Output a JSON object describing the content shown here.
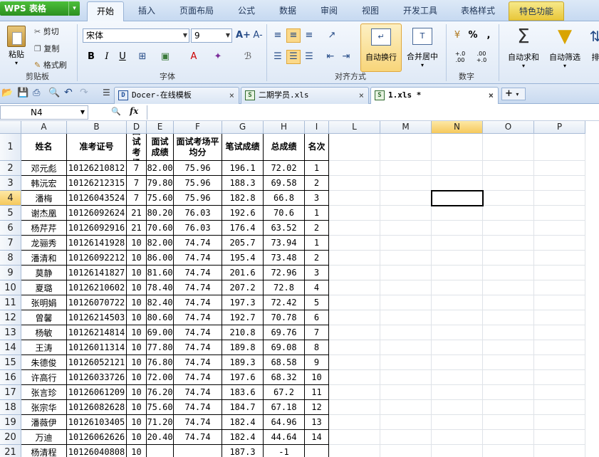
{
  "app": {
    "logo": "WPS 表格",
    "tabs": [
      "开始",
      "插入",
      "页面布局",
      "公式",
      "数据",
      "审阅",
      "视图",
      "开发工具",
      "表格样式",
      "特色功能"
    ]
  },
  "ribbon": {
    "clipboard": {
      "paste": "粘贴",
      "cut": "剪切",
      "copy": "复制",
      "format_painter": "格式刷",
      "group": "剪贴板"
    },
    "font": {
      "name": "宋体",
      "size": "9",
      "group": "字体",
      "bold": "B",
      "italic": "I",
      "underline": "U",
      "grow": "A+",
      "shrink": "A-"
    },
    "align": {
      "wrap": "自动换行",
      "merge": "合并居中",
      "group": "对齐方式"
    },
    "number": {
      "percent": "%",
      "comma": ",",
      "inc": "+.0 .00",
      "dec": ".00 +.0",
      "group": "数字"
    },
    "autosum": "自动求和",
    "autofilter": "自动筛选",
    "more": "排"
  },
  "doc_tabs": [
    {
      "label": "Docer-在线模板",
      "icon": "D"
    },
    {
      "label": "二期学员.xls",
      "icon": "S"
    },
    {
      "label": "1.xls *",
      "icon": "S"
    }
  ],
  "formula_bar": {
    "name_box": "N4",
    "fx": "fx",
    "formula": ""
  },
  "columns": [
    "A",
    "B",
    "D",
    "E",
    "F",
    "G",
    "H",
    "I",
    "L",
    "M",
    "N",
    "O",
    "P"
  ],
  "selected_column": "N",
  "selected_row": "4",
  "row_numbers": [
    "1",
    "2",
    "3",
    "4",
    "5",
    "6",
    "7",
    "8",
    "9",
    "10",
    "11",
    "12",
    "13",
    "14",
    "15",
    "16",
    "17",
    "18",
    "19",
    "20",
    "21"
  ],
  "header_row": [
    "姓名",
    "准考证号",
    "面试考场",
    "面试成绩",
    "面试考场平均分",
    "笔试成绩",
    "总成绩",
    "名次"
  ],
  "rows": [
    [
      "邓元彪",
      "10126210812",
      "7",
      "82.00",
      "75.96",
      "196.1",
      "72.02",
      "1"
    ],
    [
      "韩沅宏",
      "10126212315",
      "7",
      "79.80",
      "75.96",
      "188.3",
      "69.58",
      "2"
    ],
    [
      "潘梅",
      "10126043524",
      "7",
      "75.60",
      "75.96",
      "182.8",
      "66.8",
      "3"
    ],
    [
      "谢杰凰",
      "10126092624",
      "21",
      "80.20",
      "76.03",
      "192.6",
      "70.6",
      "1"
    ],
    [
      "杨芹芹",
      "10126092916",
      "21",
      "70.60",
      "76.03",
      "176.4",
      "63.52",
      "2"
    ],
    [
      "龙骊秀",
      "10126141928",
      "10",
      "82.00",
      "74.74",
      "205.7",
      "73.94",
      "1"
    ],
    [
      "潘清和",
      "10126092212",
      "10",
      "86.00",
      "74.74",
      "195.4",
      "73.48",
      "2"
    ],
    [
      "莫静",
      "10126141827",
      "10",
      "81.60",
      "74.74",
      "201.6",
      "72.96",
      "3"
    ],
    [
      "夏璐",
      "10126210602",
      "10",
      "78.40",
      "74.74",
      "207.2",
      "72.8",
      "4"
    ],
    [
      "张明娟",
      "10126070722",
      "10",
      "82.40",
      "74.74",
      "197.3",
      "72.42",
      "5"
    ],
    [
      "曾馨",
      "10126214503",
      "10",
      "80.60",
      "74.74",
      "192.7",
      "70.78",
      "6"
    ],
    [
      "杨敏",
      "10126214814",
      "10",
      "69.00",
      "74.74",
      "210.8",
      "69.76",
      "7"
    ],
    [
      "王涛",
      "10126011314",
      "10",
      "77.80",
      "74.74",
      "189.8",
      "69.08",
      "8"
    ],
    [
      "朱德俊",
      "10126052121",
      "10",
      "76.80",
      "74.74",
      "189.3",
      "68.58",
      "9"
    ],
    [
      "许高行",
      "10126033726",
      "10",
      "72.00",
      "74.74",
      "197.6",
      "68.32",
      "10"
    ],
    [
      "张言珍",
      "10126061209",
      "10",
      "76.20",
      "74.74",
      "183.6",
      "67.2",
      "11"
    ],
    [
      "张宗华",
      "10126082628",
      "10",
      "75.60",
      "74.74",
      "184.7",
      "67.18",
      "12"
    ],
    [
      "潘薇伊",
      "10126103405",
      "10",
      "71.20",
      "74.74",
      "182.4",
      "64.96",
      "13"
    ],
    [
      "万迪",
      "10126062626",
      "10",
      "20.40",
      "74.74",
      "182.4",
      "44.64",
      "14"
    ],
    [
      "杨清程",
      "10126040808",
      "10",
      "",
      "",
      "187.3",
      "-1",
      ""
    ]
  ]
}
